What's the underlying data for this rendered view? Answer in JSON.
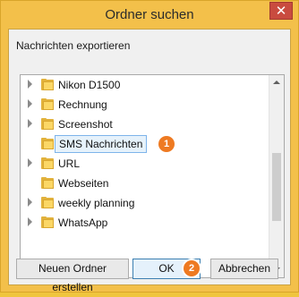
{
  "window": {
    "title": "Ordner suchen",
    "close_symbol": "✕"
  },
  "dialog": {
    "description": "Nachrichten exportieren"
  },
  "tree": {
    "items": [
      {
        "label": "Nikon D1500",
        "expandable": true,
        "selected": false
      },
      {
        "label": "Rechnung",
        "expandable": true,
        "selected": false
      },
      {
        "label": "Screenshot",
        "expandable": true,
        "selected": false
      },
      {
        "label": "SMS Nachrichten",
        "expandable": false,
        "selected": true
      },
      {
        "label": "URL",
        "expandable": true,
        "selected": false
      },
      {
        "label": "Webseiten",
        "expandable": false,
        "selected": false
      },
      {
        "label": "weekly planning",
        "expandable": true,
        "selected": false
      },
      {
        "label": "WhatsApp",
        "expandable": true,
        "selected": false
      }
    ],
    "scroll_fraction": 0.6
  },
  "badges": {
    "one": "1",
    "two": "2"
  },
  "buttons": {
    "new_folder": "Neuen Ordner erstellen",
    "ok": "OK",
    "cancel": "Abbrechen"
  },
  "colors": {
    "accent": "#ee7a22",
    "selection": "#e6f2fb",
    "title_bar": "#f3c04a"
  }
}
